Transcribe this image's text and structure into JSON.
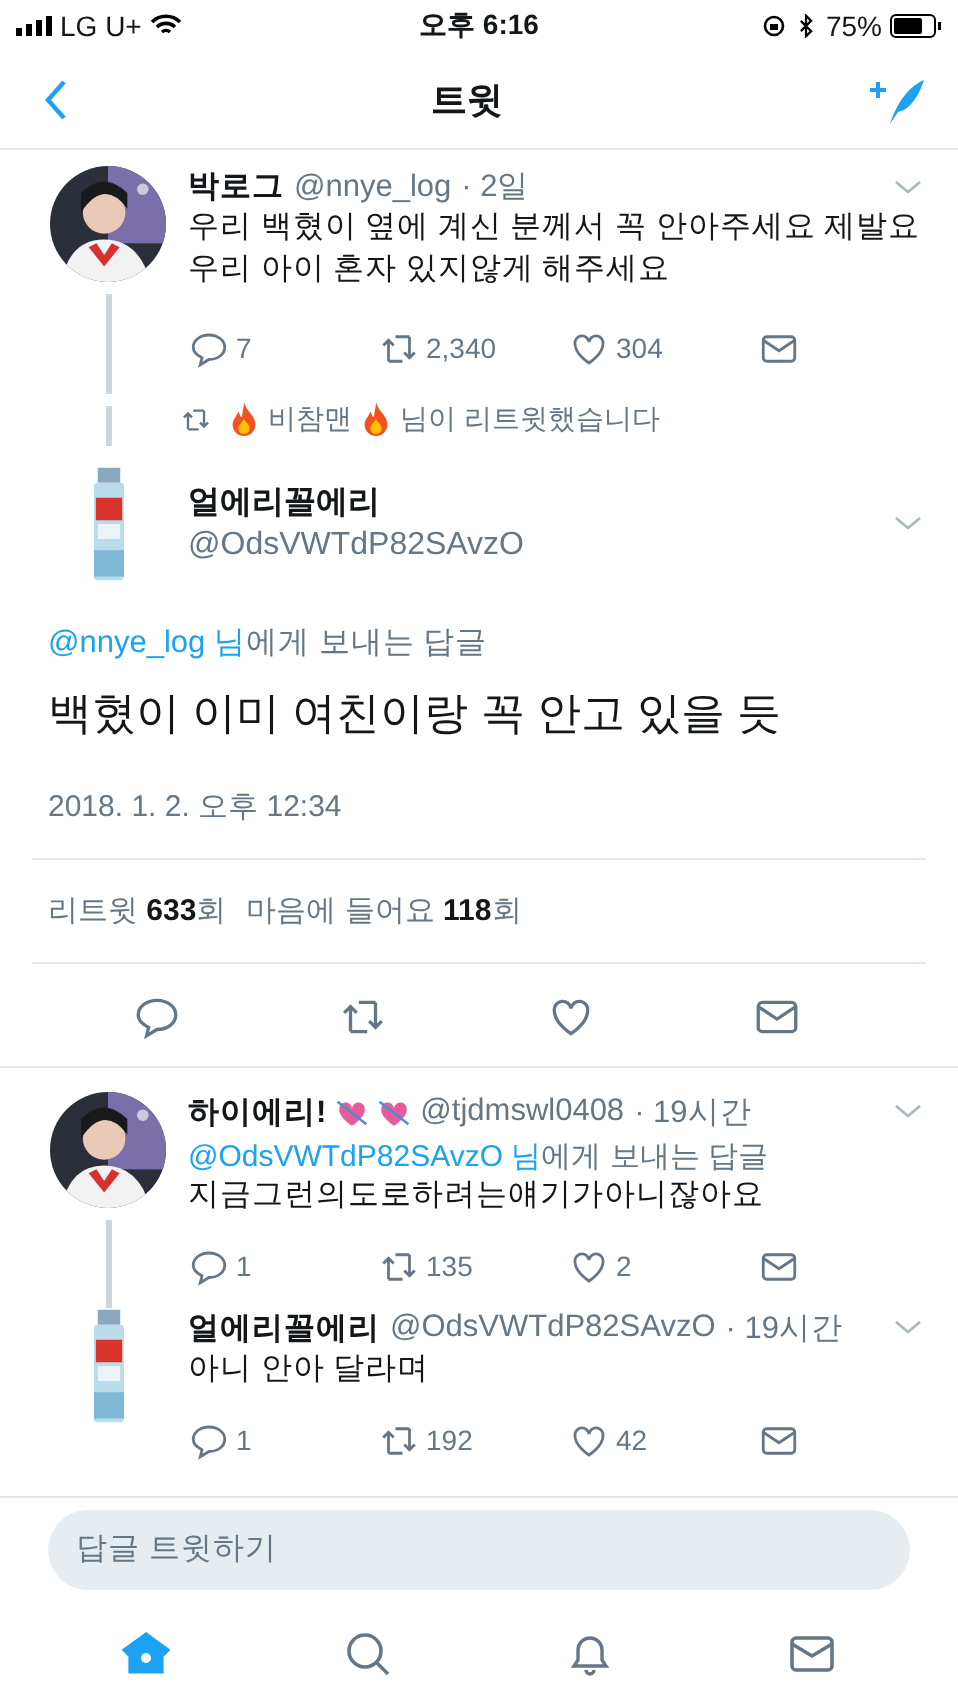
{
  "status_bar": {
    "carrier": "LG U+",
    "time": "오후 6:16",
    "battery": "75%"
  },
  "nav": {
    "title": "트윗"
  },
  "parent_tweet": {
    "name": "박로그",
    "handle": "@nnye_log",
    "time": "· 2일",
    "avatar": {
      "kind": "person"
    },
    "lines": [
      "우리 백혔이 옆에 계신 분께서 꼭 안아주세요 제발요",
      "우리 아이 혼자 있지않게 해주세요"
    ],
    "replies": "7",
    "retweets": "2,340",
    "likes": "304"
  },
  "retweeted_by": {
    "name": "비참맨",
    "suffix": "님이 리트윗했습니다",
    "fire_emoji": true
  },
  "main_tweet": {
    "name": "얼에리꼴에리",
    "handle": "@OdsVWTdP82SAvzO",
    "avatar": {
      "kind": "can"
    },
    "reply_to_mention": "@nnye_log 님",
    "reply_to_suffix": "에게 보내는 답글",
    "text": "백혔이 이미 여친이랑 꼭 안고 있을 듯",
    "timestamp": "2018. 1. 2. 오후 12:34",
    "stats": [
      "리트윗 **633**회",
      "마음에 들어요 **118**회"
    ]
  },
  "replies": [
    {
      "name": "하이에리!",
      "heart_emoji": true,
      "handle": "@tjdmswl0408",
      "time": "· 19시간",
      "avatar": {
        "kind": "person"
      },
      "reply_to_mention": "@OdsVWTdP82SAvzO 님",
      "reply_to_suffix": "에게 보내는 답글",
      "text": "지금그런의도로하려는얘기가아니잖아요",
      "replies": "1",
      "retweets": "135",
      "likes": "2",
      "thread_line": true
    },
    {
      "name": "얼에리꼴에리",
      "heart_emoji": false,
      "handle": "@OdsVWTdP82SAvzO",
      "time": "· 19시간",
      "avatar": {
        "kind": "can"
      },
      "text": "아니 안아 달라며",
      "replies": "1",
      "retweets": "192",
      "likes": "42",
      "thread_line": false
    }
  ],
  "reply_box": {
    "placeholder": "답글 트윗하기"
  },
  "tab_bar": [
    {
      "kind": "home",
      "selected": true
    },
    {
      "kind": "search",
      "selected": false
    },
    {
      "kind": "notifications",
      "selected": false
    },
    {
      "kind": "messages",
      "selected": false
    }
  ]
}
